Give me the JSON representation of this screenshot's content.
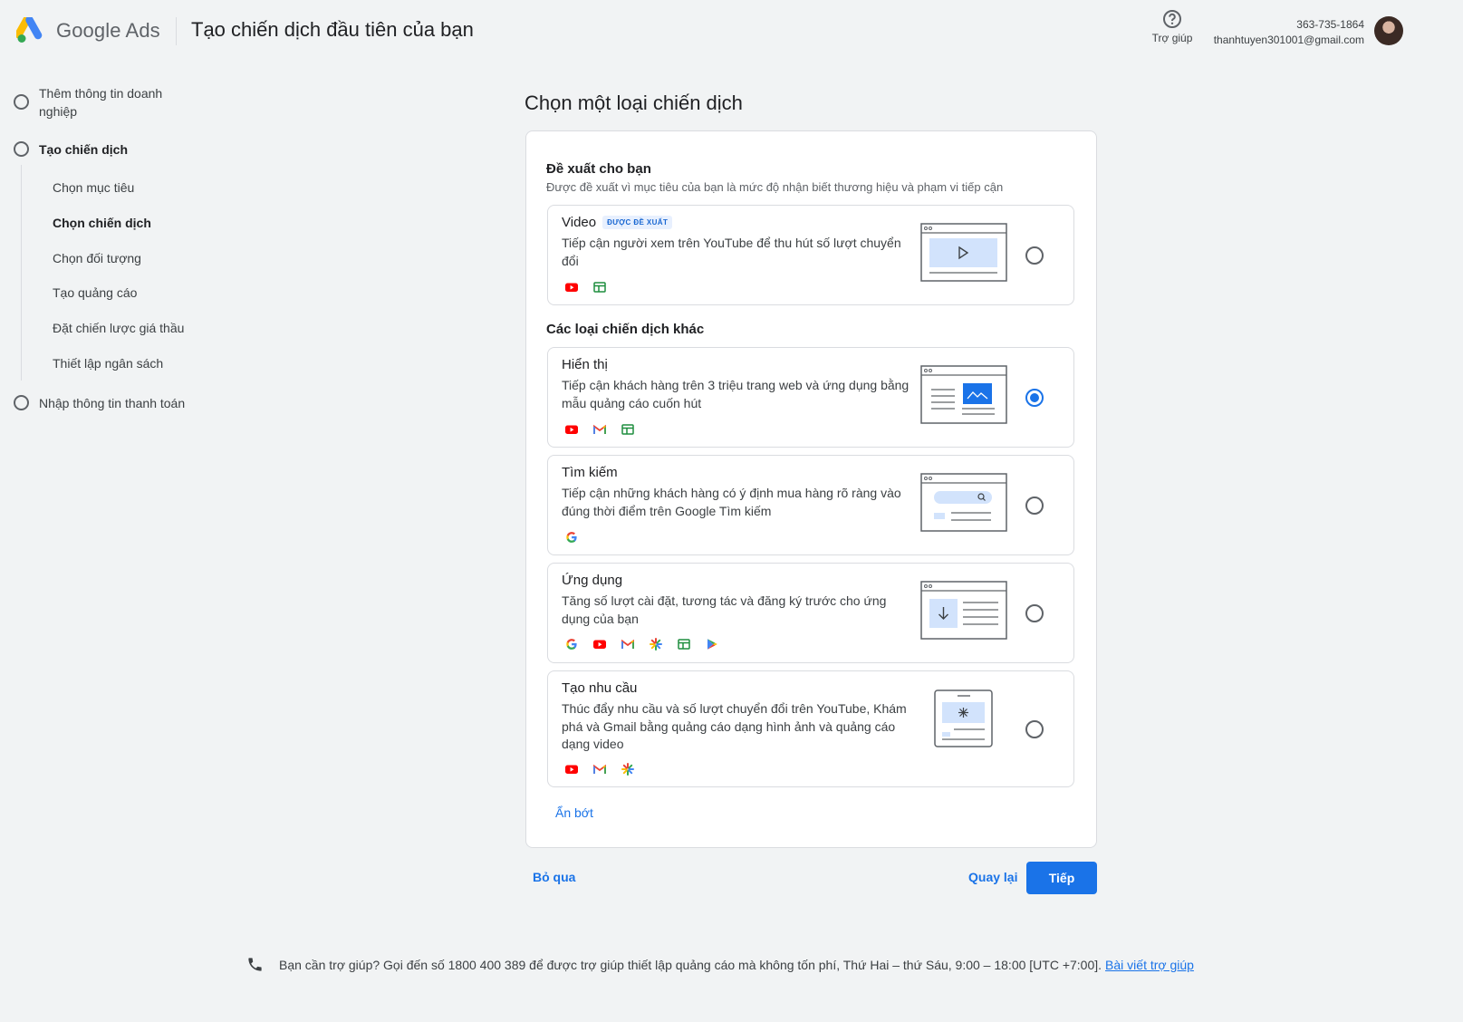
{
  "header": {
    "brand": "Google Ads",
    "title": "Tạo chiến dịch đầu tiên của bạn",
    "help_label": "Trợ giúp",
    "account_id": "363-735-1864",
    "account_email": "thanhtuyen301001@gmail.com"
  },
  "sidebar": {
    "steps": [
      {
        "label": "Thêm thông tin doanh nghiệp"
      },
      {
        "label": "Tạo chiến dịch"
      },
      {
        "label": "Nhập thông tin thanh toán"
      }
    ],
    "substeps": [
      {
        "label": "Chọn mục tiêu"
      },
      {
        "label": "Chọn chiến dịch"
      },
      {
        "label": "Chọn đối tượng"
      },
      {
        "label": "Tạo quảng cáo"
      },
      {
        "label": "Đặt chiến lược giá thầu"
      },
      {
        "label": "Thiết lập ngân sách"
      }
    ]
  },
  "main": {
    "title": "Chọn một loại chiến dịch",
    "recommended_title": "Đề xuất cho bạn",
    "recommended_sub": "Được đề xuất vì mục tiêu của bạn là mức độ nhận biết thương hiệu và phạm vi tiếp cận",
    "other_title": "Các loại chiến dịch khác",
    "options": [
      {
        "title": "Video",
        "badge": "ĐƯỢC ĐỀ XUẤT",
        "desc": "Tiếp cận người xem trên YouTube để thu hút số lượt chuyển đổi",
        "icons": [
          "youtube-icon",
          "display-network-icon"
        ],
        "selected": false
      },
      {
        "title": "Hiển thị",
        "desc": "Tiếp cận khách hàng trên 3 triệu trang web và ứng dụng bằng mẫu quảng cáo cuốn hút",
        "icons": [
          "youtube-icon",
          "gmail-icon",
          "display-network-icon"
        ],
        "selected": true
      },
      {
        "title": "Tìm kiếm",
        "desc": "Tiếp cận những khách hàng có ý định mua hàng rõ ràng vào đúng thời điểm trên Google Tìm kiếm",
        "icons": [
          "google-icon"
        ],
        "selected": false
      },
      {
        "title": "Ứng dụng",
        "desc": "Tăng số lượt cài đặt, tương tác và đăng ký trước cho ứng dụng của bạn",
        "icons": [
          "google-icon",
          "youtube-icon",
          "gmail-icon",
          "discover-icon",
          "display-network-icon",
          "google-play-icon"
        ],
        "selected": false
      },
      {
        "title": "Tạo nhu cầu",
        "desc": "Thúc đẩy nhu cầu và số lượt chuyển đổi trên YouTube, Khám phá và Gmail bằng quảng cáo dạng hình ảnh và quảng cáo dạng video",
        "icons": [
          "youtube-icon",
          "gmail-icon",
          "discover-icon"
        ],
        "selected": false
      }
    ],
    "show_less": "Ẩn bớt",
    "skip": "Bỏ qua",
    "back": "Quay lại",
    "next": "Tiếp"
  },
  "footer": {
    "text": "Bạn cần trợ giúp? Gọi đến số 1800 400 389 để được trợ giúp thiết lập quảng cáo mà không tốn phí, Thứ Hai – thứ Sáu, 9:00 – 18:00 [UTC +7:00].",
    "link": "Bài viết trợ giúp"
  },
  "colors": {
    "accent": "#1a73e8",
    "background": "#f1f3f4",
    "youtube": "#ff0000"
  }
}
